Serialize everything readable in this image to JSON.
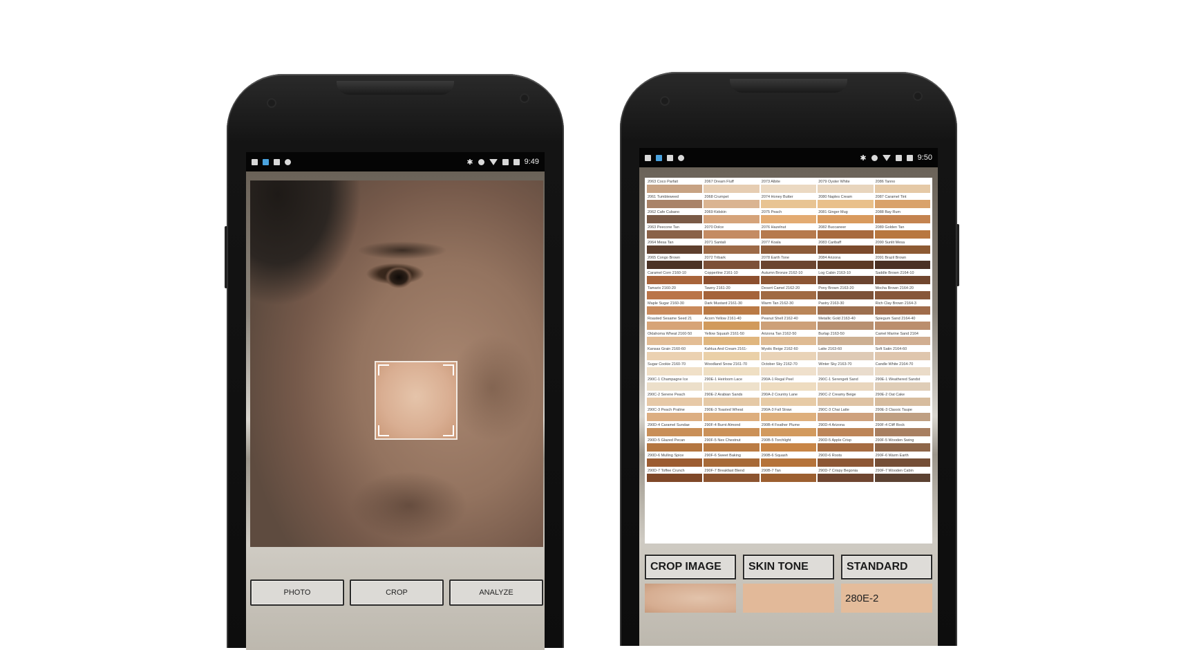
{
  "phone1": {
    "status": {
      "time": "9:49"
    },
    "buttons": {
      "photo": "PHOTO",
      "crop": "CROP",
      "analyze": "ANALYZE"
    }
  },
  "phone2": {
    "status": {
      "time": "9:50"
    },
    "swatches": [
      {
        "name": "2063 Coco Parfait",
        "color": "#c7a283"
      },
      {
        "name": "2067 Dream Fluff",
        "color": "#e6cdb2"
      },
      {
        "name": "2073 Albite",
        "color": "#ebd9c2"
      },
      {
        "name": "2079 Oyster White",
        "color": "#e8d5bd"
      },
      {
        "name": "2086 Tanno",
        "color": "#e5c9a6"
      },
      {
        "name": "2061 Tumbleweed",
        "color": "#a98368"
      },
      {
        "name": "2068 Crumpet",
        "color": "#dab491"
      },
      {
        "name": "2074 Honey Butter",
        "color": "#e8c492"
      },
      {
        "name": "2080 Naples Cream",
        "color": "#e9c08a"
      },
      {
        "name": "2087 Caramel Tint",
        "color": "#d9a26b"
      },
      {
        "name": "2062 Cafe Cubano",
        "color": "#7a5a46"
      },
      {
        "name": "2069 Kidskin",
        "color": "#d5a37a"
      },
      {
        "name": "2075 Peach",
        "color": "#e3ab72"
      },
      {
        "name": "2081 Ginger Mug",
        "color": "#d99a5d"
      },
      {
        "name": "2088 Bay Rum",
        "color": "#c4834f"
      },
      {
        "name": "2063 Peecone Tan",
        "color": "#8a6248"
      },
      {
        "name": "2070 Dolce",
        "color": "#c48b63"
      },
      {
        "name": "2076 Hazelnut",
        "color": "#b67a4d"
      },
      {
        "name": "2082 Buccaneer",
        "color": "#a86a3e"
      },
      {
        "name": "2089 Golden Tan",
        "color": "#b8773f"
      },
      {
        "name": "2064 Mesa Tan",
        "color": "#5e3f2d"
      },
      {
        "name": "2071 Santali",
        "color": "#9c6a47"
      },
      {
        "name": "2077 Koala",
        "color": "#8c5b39"
      },
      {
        "name": "2083 Caribaff",
        "color": "#7b4a2c"
      },
      {
        "name": "2090 Sunlit Mesa",
        "color": "#8d5a33"
      },
      {
        "name": "2065 Congo Brown",
        "color": "#4b3326"
      },
      {
        "name": "2072 Tribark",
        "color": "#7c5038"
      },
      {
        "name": "2078 Earth Tone",
        "color": "#6b4530"
      },
      {
        "name": "2084 Arizona",
        "color": "#5c3a26"
      },
      {
        "name": "2091 Brazil Brown",
        "color": "#4a3024"
      },
      {
        "name": "Caramel Corn 2160-10",
        "color": "#a8643a"
      },
      {
        "name": "Copperline 2161-10",
        "color": "#8c4f2e"
      },
      {
        "name": "Autumn Bronze 2162-10",
        "color": "#8b5533"
      },
      {
        "name": "Log Cabin 2163-10",
        "color": "#6a4430"
      },
      {
        "name": "Saddle Brown 2164-10",
        "color": "#70462e"
      },
      {
        "name": "Tamarix 2160-20",
        "color": "#ba7548"
      },
      {
        "name": "Tawny 2161-20",
        "color": "#a5633a"
      },
      {
        "name": "Desert Camel 2162-20",
        "color": "#a06a43"
      },
      {
        "name": "Pony Brown 2163-20",
        "color": "#7c5238"
      },
      {
        "name": "Mocha Brown 2164-20",
        "color": "#87573a"
      },
      {
        "name": "Maple Sugar 2160-30",
        "color": "#c98a5b"
      },
      {
        "name": "Dark Mustard 2161-30",
        "color": "#ba7a45"
      },
      {
        "name": "Warm Tan 2162-30",
        "color": "#b98558"
      },
      {
        "name": "Pastry 2163-30",
        "color": "#9c6f4f"
      },
      {
        "name": "Rich Clay Brown 2164-3",
        "color": "#a06c4b"
      },
      {
        "name": "Roasted Sesame Seed 21",
        "color": "#d7a477"
      },
      {
        "name": "Acorn Yellow 2161-40",
        "color": "#d19a5c"
      },
      {
        "name": "Peanut Shell 2162-40",
        "color": "#cda078"
      },
      {
        "name": "Metallic Gold 2163-40",
        "color": "#b89070"
      },
      {
        "name": "Spiegum Sand 2164-40",
        "color": "#bb8e6d"
      },
      {
        "name": "Oklahoma Wheat 2160-50",
        "color": "#e3bd95"
      },
      {
        "name": "Yellow Squash 2161-50",
        "color": "#e0b67e"
      },
      {
        "name": "Arizona Tan 2162-50",
        "color": "#dfbb93"
      },
      {
        "name": "Burlap 2163-50",
        "color": "#cdb093"
      },
      {
        "name": "Camel Marine Sand 2164",
        "color": "#d1ae91"
      },
      {
        "name": "Kansas Grain 2160-60",
        "color": "#ebd1b1"
      },
      {
        "name": "Kahlua And Cream 2161-",
        "color": "#ead0a8"
      },
      {
        "name": "Mystic Beige 2162-60",
        "color": "#e9d3b7"
      },
      {
        "name": "Latte 2163-60",
        "color": "#decab5"
      },
      {
        "name": "Soft Satin 2164-60",
        "color": "#dfc6ad"
      },
      {
        "name": "Sugar Cookie 2160-70",
        "color": "#f0e0c8"
      },
      {
        "name": "Woodland Snow 2161-70",
        "color": "#efdfc3"
      },
      {
        "name": "October Sky 2162-70",
        "color": "#efe0cc"
      },
      {
        "name": "Winter Sky 2163-70",
        "color": "#e9dccd"
      },
      {
        "name": "Candle White 2164-70",
        "color": "#eadbc8"
      },
      {
        "name": "290C-1 Champagne Ice",
        "color": "#ecdfca"
      },
      {
        "name": "290E-1 Heirloom Lace",
        "color": "#eee1cb"
      },
      {
        "name": "290A-1 Regal Peel",
        "color": "#eedcc0"
      },
      {
        "name": "290C-1 Serengeti Sand",
        "color": "#e9d6bd"
      },
      {
        "name": "290E-1 Weathered Sandst",
        "color": "#dfcdb7"
      },
      {
        "name": "290C-2 Serene Peach",
        "color": "#e7c9a7"
      },
      {
        "name": "290E-2 Arabian Sands",
        "color": "#e5c9a6"
      },
      {
        "name": "290A-2 Country Lane",
        "color": "#e7cba6"
      },
      {
        "name": "290C-2 Creamy Beige",
        "color": "#dfc3a4"
      },
      {
        "name": "290E-2 Oat Cake",
        "color": "#d7bc9e"
      },
      {
        "name": "290C-3 Peach Praline",
        "color": "#dcae82"
      },
      {
        "name": "290E-3 Toasted Wheat",
        "color": "#ddae7e"
      },
      {
        "name": "290A-3 Fall Straw",
        "color": "#deaf7c"
      },
      {
        "name": "290C-3 Chai Latte",
        "color": "#cea17d"
      },
      {
        "name": "290E-3 Classic Taupe",
        "color": "#bf9f82"
      },
      {
        "name": "290D-4 Caramel Sundae",
        "color": "#c98f58"
      },
      {
        "name": "290F-4 Burnt Almond",
        "color": "#cb9158"
      },
      {
        "name": "290B-4 Feather Plume",
        "color": "#d29a5e"
      },
      {
        "name": "290D-4 Arizona",
        "color": "#bd8558"
      },
      {
        "name": "290F-4 Cliff Rock",
        "color": "#a87f61"
      },
      {
        "name": "290D-5 Glazed Pecan",
        "color": "#b47640"
      },
      {
        "name": "290F-5 Nex Chestnut",
        "color": "#ba7c44"
      },
      {
        "name": "290B-5 Torchlight",
        "color": "#c88546"
      },
      {
        "name": "290D-5 Apple Crisp",
        "color": "#a66c41"
      },
      {
        "name": "290F-5 Wooden Swing",
        "color": "#8e6649"
      },
      {
        "name": "290D-6 Mulling Spice",
        "color": "#9c5c31"
      },
      {
        "name": "290F-6 Sweet Baking",
        "color": "#a76a38"
      },
      {
        "name": "290B-6 Squash",
        "color": "#b5733a"
      },
      {
        "name": "290D-6 Roots",
        "color": "#8d5735"
      },
      {
        "name": "290F-6 Warm Earth",
        "color": "#754f37"
      },
      {
        "name": "290D-7 Toffee Crunch",
        "color": "#7f4828"
      },
      {
        "name": "290F-7 Breakfast Blend",
        "color": "#8c5430"
      },
      {
        "name": "290B-7 Tan",
        "color": "#9c5f30"
      },
      {
        "name": "290D-7 Crispy Begonia",
        "color": "#6f4631"
      },
      {
        "name": "290F-7 Wooden Cabin",
        "color": "#5c4232"
      }
    ],
    "results": {
      "crop_label": "CROP IMAGE",
      "tone_label": "SKIN TONE",
      "standard_label": "STANDARD",
      "standard_value": "280E-2"
    }
  }
}
